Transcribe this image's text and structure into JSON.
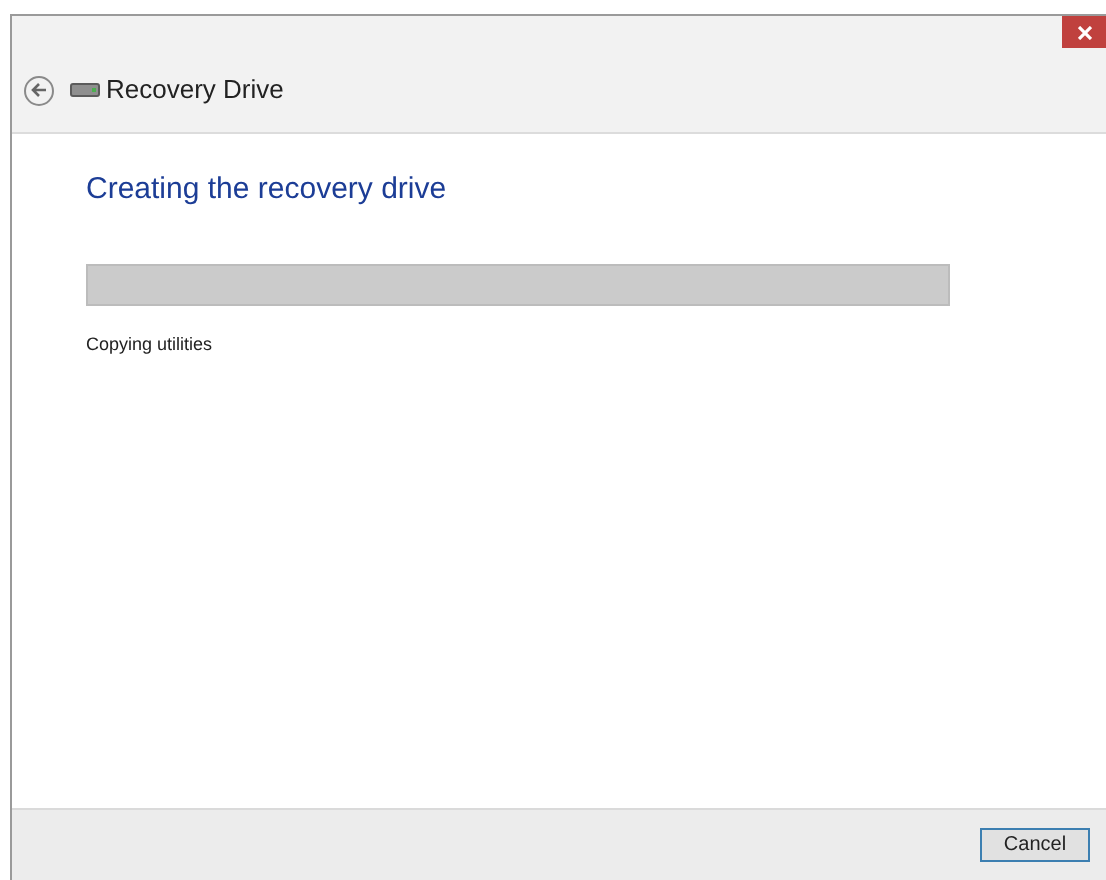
{
  "window": {
    "title": "Recovery Drive"
  },
  "heading": "Creating the recovery drive",
  "progress": {
    "level": 0
  },
  "status": "Copying utilities",
  "buttons": [
    "Cancel"
  ]
}
